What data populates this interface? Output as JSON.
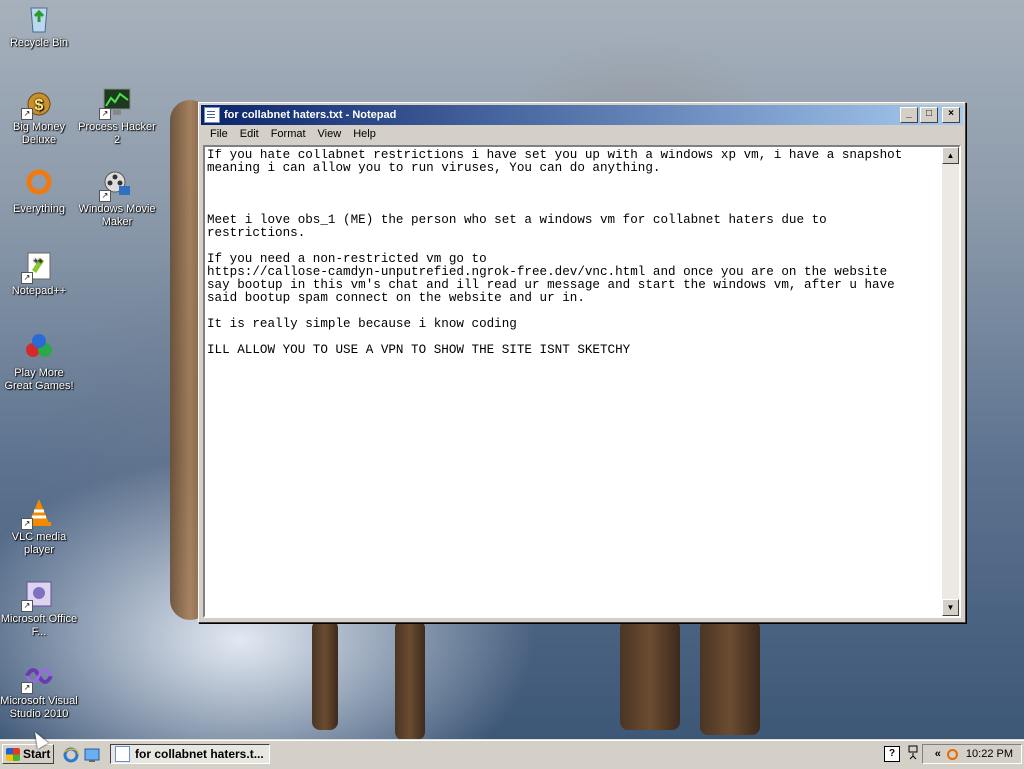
{
  "desktop": {
    "icons": [
      {
        "id": "recycle-bin",
        "label": "Recycle Bin",
        "icon": "recycle-bin-icon"
      },
      {
        "id": "big-money",
        "label": "Big Money Deluxe",
        "icon": "money-bag-icon"
      },
      {
        "id": "process-hacker",
        "label": "Process Hacker 2",
        "icon": "monitor-chart-icon"
      },
      {
        "id": "everything",
        "label": "Everything",
        "icon": "search-ring-icon"
      },
      {
        "id": "movie-maker",
        "label": "Windows Movie Maker",
        "icon": "film-reel-icon"
      },
      {
        "id": "notepadpp",
        "label": "Notepad++",
        "icon": "notepadpp-icon"
      },
      {
        "id": "play-more",
        "label": "Play More Great Games!",
        "icon": "games-icon"
      },
      {
        "id": "vlc",
        "label": "VLC media player",
        "icon": "vlc-cone-icon"
      },
      {
        "id": "ms-office",
        "label": "Microsoft Office F...",
        "icon": "office-doc-icon"
      },
      {
        "id": "visual-studio",
        "label": "Microsoft Visual Studio 2010",
        "icon": "visual-studio-icon"
      }
    ]
  },
  "window": {
    "title": "for collabnet haters.txt - Notepad",
    "menu": [
      "File",
      "Edit",
      "Format",
      "View",
      "Help"
    ],
    "controls": {
      "minimize": "_",
      "maximize": "□",
      "close": "×"
    },
    "content": "If you hate collabnet restrictions i have set you up with a windows xp vm, i have a snapshot\nmeaning i can allow you to run viruses, You can do anything.\n\n\n\nMeet i love obs_1 (ME) the person who set a windows vm for collabnet haters due to\nrestrictions.\n\nIf you need a non-restricted vm go to\nhttps://callose-camdyn-unputrefied.ngrok-free.dev/vnc.html and once you are on the website\nsay bootup in this vm's chat and ill read ur message and start the windows vm, after u have\nsaid bootup spam connect on the website and ur in.\n\nIt is really simple because i know coding\n\nILL ALLOW YOU TO USE A VPN TO SHOW THE SITE ISNT SKETCHY"
  },
  "taskbar": {
    "start_label": "Start",
    "task_label": "for collabnet haters.t...",
    "help_glyph": "?",
    "tray_chevron": "«",
    "clock": "10:22 PM"
  }
}
